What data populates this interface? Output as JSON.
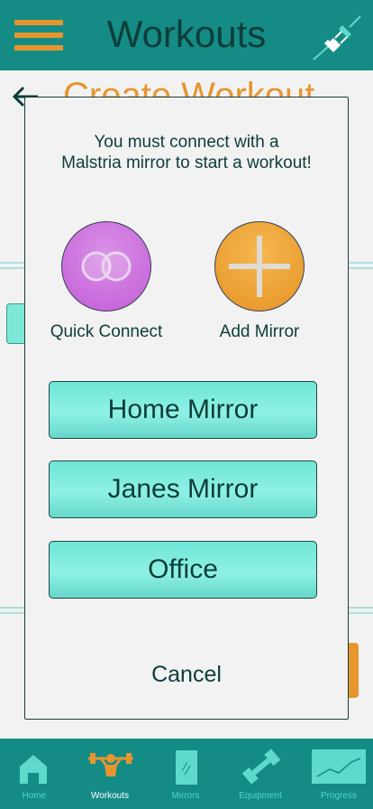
{
  "header": {
    "title": "Workouts",
    "menu_icon": "hamburger-icon",
    "connect_icon": "plug-icon"
  },
  "page": {
    "subtitle": "Create Workout"
  },
  "modal": {
    "message_line1": "You must connect with a",
    "message_line2": "Malstria mirror to start a workout!",
    "quick_connect_label": "Quick Connect",
    "add_mirror_label": "Add Mirror",
    "mirrors": [
      "Home Mirror",
      "Janes Mirror",
      "Office"
    ],
    "cancel_label": "Cancel"
  },
  "nav": {
    "items": [
      {
        "label": "Home",
        "icon": "home-icon",
        "active": false
      },
      {
        "label": "Workouts",
        "icon": "weightlifter-icon",
        "active": true
      },
      {
        "label": "Mirrors",
        "icon": "mirror-icon",
        "active": false
      },
      {
        "label": "Equipment",
        "icon": "dumbbell-icon",
        "active": false
      },
      {
        "label": "Progress",
        "icon": "chart-icon",
        "active": false
      }
    ]
  },
  "colors": {
    "teal": "#148c85",
    "orange": "#e6952f",
    "mint": "#7ee8d8",
    "purple": "#c45cd9"
  }
}
